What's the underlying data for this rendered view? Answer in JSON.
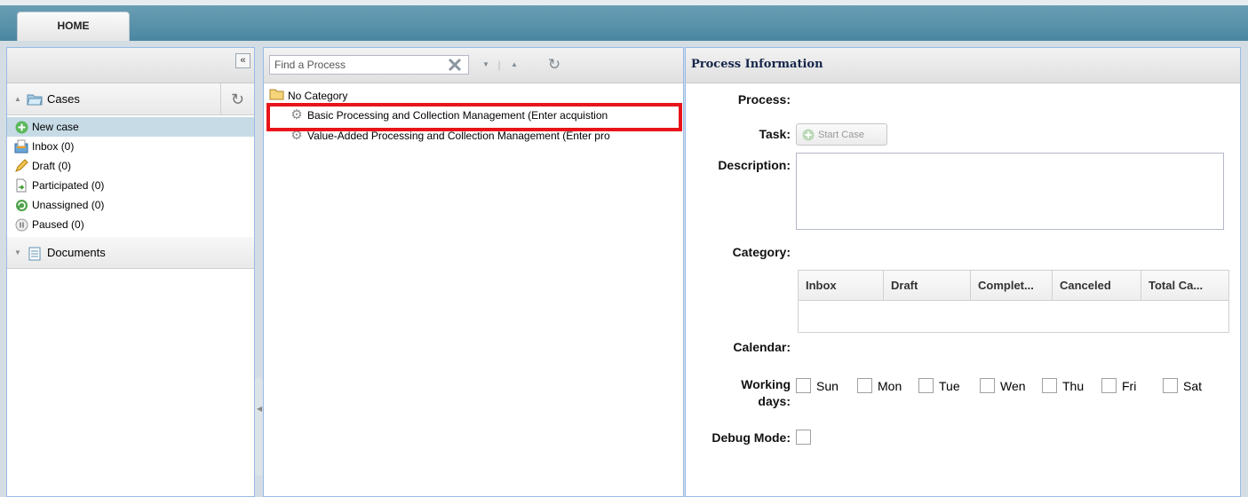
{
  "topbar": {
    "home_tab": "HOME"
  },
  "left": {
    "collapse_icon": "double-chevron-left-icon",
    "cases_header": "Cases",
    "case_items": [
      {
        "label": "New case",
        "icon": "plus-circle-icon",
        "selected": true
      },
      {
        "label": "Inbox (0)",
        "icon": "inbox-icon"
      },
      {
        "label": "Draft (0)",
        "icon": "pencil-icon"
      },
      {
        "label": "Participated (0)",
        "icon": "document-arrow-icon"
      },
      {
        "label": "Unassigned (0)",
        "icon": "recycle-icon"
      },
      {
        "label": "Paused (0)",
        "icon": "pause-icon"
      }
    ],
    "documents_header": "Documents"
  },
  "middle": {
    "search_placeholder": "Find a Process",
    "tree": {
      "category": "No Category",
      "processes": [
        "Basic Processing and Collection Management (Enter acquistion",
        "Value-Added Processing and Collection Management (Enter pro"
      ]
    }
  },
  "right": {
    "header": "Process Information",
    "process_label": "Process:",
    "task_label": "Task:",
    "start_case_label": "Start Case",
    "description_label": "Description:",
    "category_label": "Category:",
    "grid_columns": [
      "Inbox",
      "Draft",
      "Complet...",
      "Canceled",
      "Total Ca..."
    ],
    "calendar_label": "Calendar:",
    "working_label_1": "Working",
    "working_label_2": "days:",
    "days": [
      "Sun",
      "Mon",
      "Tue",
      "Wen",
      "Thu",
      "Fri",
      "Sat"
    ],
    "debug_label": "Debug Mode:"
  },
  "colors": {
    "highlight": "#e8141b",
    "topbar": "#4a86a0",
    "selected_row": "#c7dbe6"
  }
}
